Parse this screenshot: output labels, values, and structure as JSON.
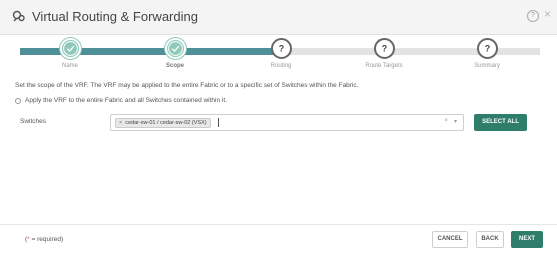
{
  "header": {
    "title": "Virtual Routing & Forwarding"
  },
  "steps": [
    {
      "label": "Name",
      "state": "done"
    },
    {
      "label": "Scope",
      "state": "active"
    },
    {
      "label": "Routing",
      "state": "todo"
    },
    {
      "label": "Route Targets",
      "state": "todo"
    },
    {
      "label": "Summary",
      "state": "todo"
    }
  ],
  "scope": {
    "description": "Set the scope of the VRF. The VRF may be applied to the entire Fabric or to a specific set of Switches within the Fabric.",
    "radio_label": "Apply the VRF to the entire Fabric and all Switches contained within it.",
    "switches_label": "Switches",
    "selected_switch": "cedar-sw-01 / cedar-sw-02 (VSX)",
    "select_all_label": "SELECT ALL"
  },
  "footer": {
    "required_star": "*",
    "required_text": " = required)",
    "required_open": "(",
    "cancel_label": "CANCEL",
    "back_label": "BACK",
    "next_label": "NEXT"
  },
  "colors": {
    "accent": "#2f7d6b",
    "progress": "#4e8f98",
    "check": "#8ec9b9"
  }
}
